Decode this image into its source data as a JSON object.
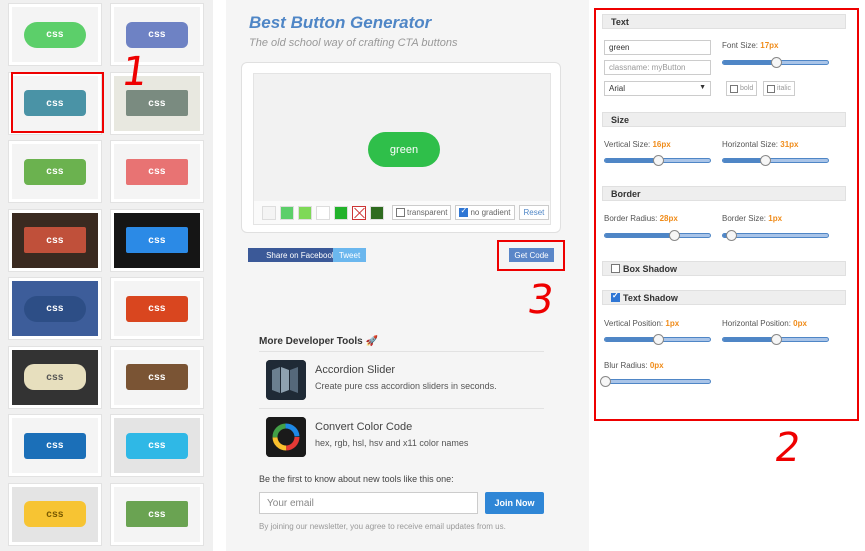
{
  "gallery": {
    "tiles": [
      {
        "label": "css",
        "bg": "#5ccf6a",
        "tile_bg": "#f4f4f4",
        "radius": "13px"
      },
      {
        "label": "css",
        "bg": "#6e82c4",
        "tile_bg": "#f4f4f4",
        "radius": "6px"
      },
      {
        "label": "css",
        "bg": "#4a93a6",
        "tile_bg": "#f4f4f4",
        "radius": "4px"
      },
      {
        "label": "css",
        "bg": "#7a8b80",
        "tile_bg": "#e8e8e0",
        "radius": "2px"
      },
      {
        "label": "css",
        "bg": "#6bb24f",
        "tile_bg": "#f4f4f4",
        "radius": "4px"
      },
      {
        "label": "css",
        "bg": "#e87373",
        "tile_bg": "#f4f4f4",
        "radius": "2px"
      },
      {
        "label": "css",
        "bg": "#c0503a",
        "tile_bg": "#3a2a20",
        "radius": "2px"
      },
      {
        "label": "css",
        "bg": "#2b8ae6",
        "tile_bg": "#151515",
        "radius": "2px"
      },
      {
        "label": "css",
        "bg": "#2d4e86",
        "tile_bg": "#3d5d9a",
        "radius": "14px"
      },
      {
        "label": "css",
        "bg": "#d9461f",
        "tile_bg": "#f4f4f4",
        "radius": "3px"
      },
      {
        "label": "css",
        "bg": "#e7dfbe",
        "tile_bg": "#333333",
        "radius": "10px",
        "color": "#555"
      },
      {
        "label": "css",
        "bg": "#7a5434",
        "tile_bg": "#f4f4f4",
        "radius": "3px"
      },
      {
        "label": "css",
        "bg": "#1b6fb8",
        "tile_bg": "#f4f4f4",
        "radius": "3px"
      },
      {
        "label": "css",
        "bg": "#2fb8e6",
        "tile_bg": "#e4e4e4",
        "radius": "4px"
      },
      {
        "label": "css",
        "bg": "#f7c433",
        "tile_bg": "#e4e4e4",
        "radius": "6px",
        "color": "#7a5a00"
      },
      {
        "label": "css",
        "bg": "#6aa352",
        "tile_bg": "#f4f4f4",
        "radius": "2px"
      }
    ]
  },
  "annotations": {
    "one": "1",
    "two": "2",
    "three": "3",
    "color": "#e00000"
  },
  "header": {
    "title": "Best Button Generator",
    "subtitle": "The old school way of crafting CTA buttons"
  },
  "preview": {
    "button_label": "green",
    "button_color": "#2fbf4a",
    "swatches": [
      "#f4f4f4",
      "#5ccf6a",
      "#7ed957",
      "#ffffff",
      "#22b22b",
      "x",
      "#2e6b1f"
    ],
    "transparent_label": "transparent",
    "no_gradient_label": "no gradient",
    "reset_label": "Reset"
  },
  "share": {
    "facebook_label": "Share on Facebook",
    "tweet_label": "Tweet",
    "get_code_label": "Get Code"
  },
  "more_tools": {
    "heading": "More Developer Tools 🚀",
    "items": [
      {
        "name": "Accordion Slider",
        "desc": "Create pure css accordion sliders in seconds."
      },
      {
        "name": "Convert Color Code",
        "desc": "hex, rgb, hsl, hsv and x11 color names"
      }
    ]
  },
  "newsletter": {
    "text": "Be the first to know about new tools like this one:",
    "email_placeholder": "Your email",
    "join_label": "Join Now",
    "disclaimer": "By joining our newsletter, you agree to receive email updates from us."
  },
  "panel": {
    "text": {
      "heading": "Text",
      "text_value": "green",
      "classname_placeholder": "classname: myButton",
      "font_family": "Arial",
      "font_size_label": "Font Size:",
      "font_size_value": "17px",
      "font_size_level": 0.5,
      "bold_label": "bold",
      "italic_label": "italic"
    },
    "size": {
      "heading": "Size",
      "vertical_label": "Vertical Size:",
      "vertical_value": "16px",
      "vertical_level": 0.5,
      "horizontal_label": "Horizontal Size:",
      "horizontal_value": "31px",
      "horizontal_level": 0.4
    },
    "border": {
      "heading": "Border",
      "radius_label": "Border Radius:",
      "radius_value": "28px",
      "radius_level": 0.66,
      "size_label": "Border Size:",
      "size_value": "1px",
      "size_level": 0.08
    },
    "box_shadow": {
      "heading": "Box Shadow",
      "checked": false
    },
    "text_shadow": {
      "heading": "Text Shadow",
      "checked": true,
      "vpos_label": "Vertical Position:",
      "vpos_value": "1px",
      "vpos_level": 0.5,
      "hpos_label": "Horizontal Position:",
      "hpos_value": "0px",
      "hpos_level": 0.5,
      "blur_label": "Blur Radius:",
      "blur_value": "0px",
      "blur_level": 0.0
    }
  }
}
